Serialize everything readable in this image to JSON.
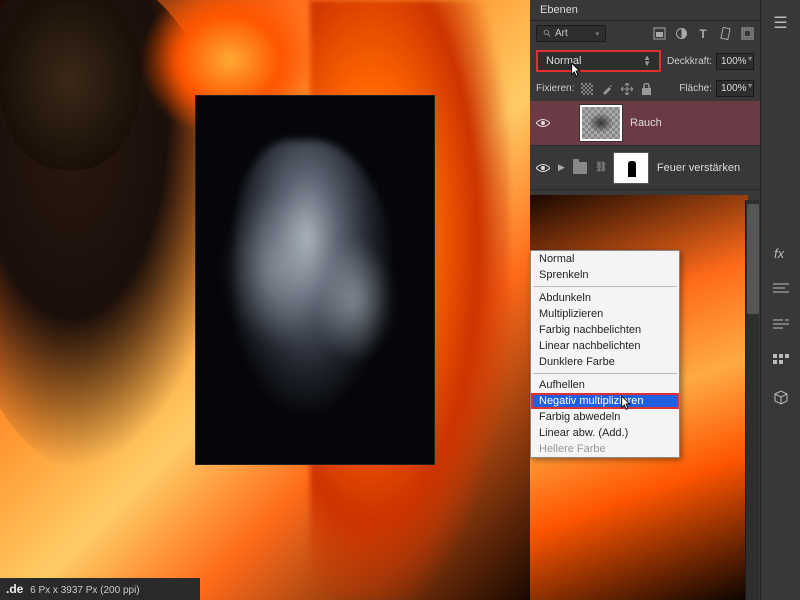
{
  "panel": {
    "title": "Ebenen"
  },
  "filter": {
    "search_label": "Art"
  },
  "blend": {
    "current": "Normal",
    "opacity_label": "Deckkraft:",
    "opacity_value": "100%",
    "fill_label": "Fläche:",
    "fill_value": "100%"
  },
  "lock": {
    "label": "Fixieren:"
  },
  "layers": [
    {
      "name": "Rauch"
    },
    {
      "name": "Feuer verstärken"
    }
  ],
  "dropdown": {
    "group1": [
      "Normal",
      "Sprenkeln"
    ],
    "group2": [
      "Abdunkeln",
      "Multiplizieren",
      "Farbig nachbelichten",
      "Linear nachbelichten",
      "Dunklere Farbe"
    ],
    "group3": [
      "Aufhellen",
      "Negativ multiplizieren",
      "Farbig abwedeln",
      "Linear abw. (Add.)",
      "Hellere Farbe"
    ]
  },
  "status": {
    "suffix": ".de",
    "info": "6 Px x 3937 Px (200 ppi)"
  }
}
